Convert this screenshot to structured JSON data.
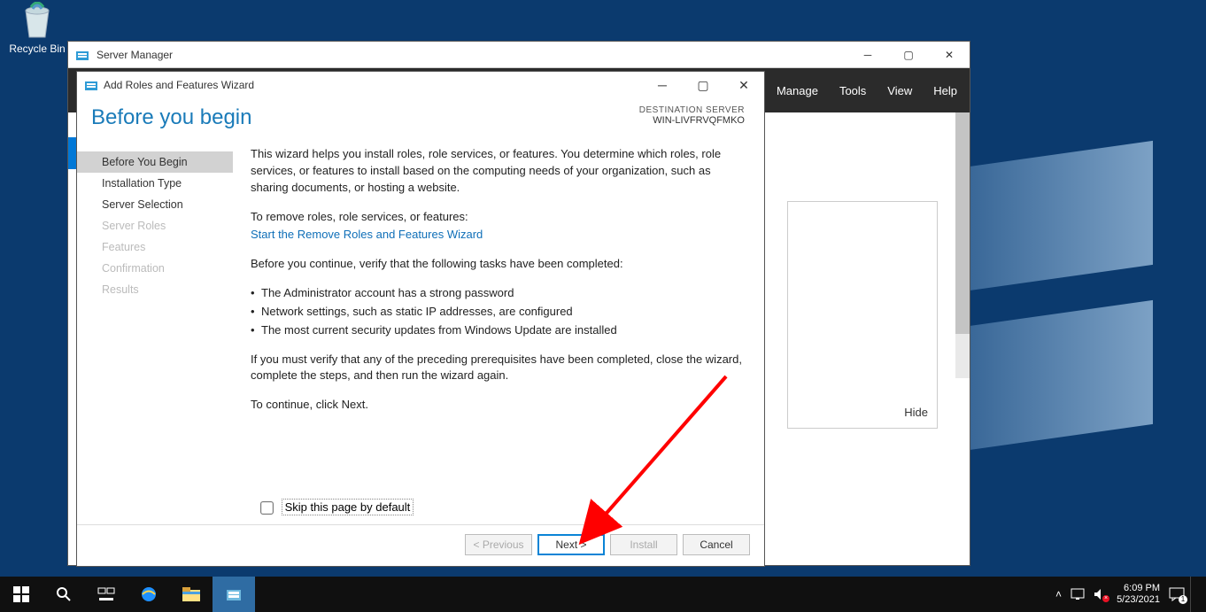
{
  "desktop": {
    "recycle_bin_label": "Recycle Bin"
  },
  "server_manager": {
    "title": "Server Manager",
    "menu": {
      "manage": "Manage",
      "tools": "Tools",
      "view": "View",
      "help": "Help"
    },
    "hide": "Hide"
  },
  "wizard": {
    "title": "Add Roles and Features Wizard",
    "heading": "Before you begin",
    "dest_label": "DESTINATION SERVER",
    "dest_server": "WIN-LIVFRVQFMKO",
    "nav": {
      "begin": "Before You Begin",
      "type": "Installation Type",
      "selection": "Server Selection",
      "roles": "Server Roles",
      "features": "Features",
      "confirm": "Confirmation",
      "results": "Results"
    },
    "p1": "This wizard helps you install roles, role services, or features. You determine which roles, role services, or features to install based on the computing needs of your organization, such as sharing documents, or hosting a website.",
    "p2": "To remove roles, role services, or features:",
    "link": "Start the Remove Roles and Features Wizard",
    "p3": "Before you continue, verify that the following tasks have been completed:",
    "bullets": {
      "b1": "The Administrator account has a strong password",
      "b2": "Network settings, such as static IP addresses, are configured",
      "b3": "The most current security updates from Windows Update are installed"
    },
    "p4": "If you must verify that any of the preceding prerequisites have been completed, close the wizard, complete the steps, and then run the wizard again.",
    "p5": "To continue, click Next.",
    "skip_label": "Skip this page by default",
    "buttons": {
      "previous": "< Previous",
      "next": "Next >",
      "install": "Install",
      "cancel": "Cancel"
    }
  },
  "taskbar": {
    "time": "6:09 PM",
    "date": "5/23/2021"
  }
}
